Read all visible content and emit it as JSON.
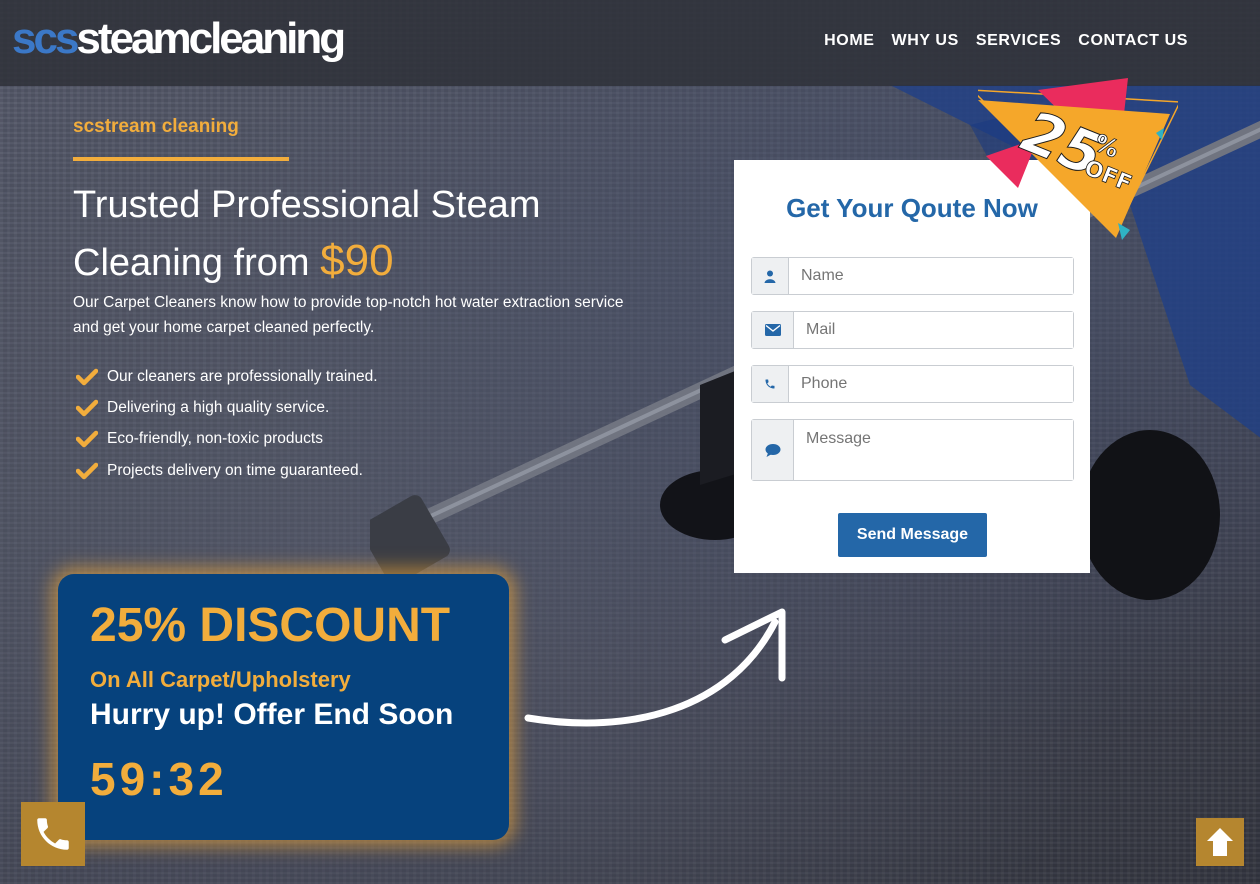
{
  "header": {
    "logo_prefix": "scs",
    "logo_suffix": "steamcleaning",
    "nav": [
      "HOME",
      "WHY US",
      "SERVICES",
      "CONTACT US"
    ]
  },
  "hero": {
    "kicker": "scstream cleaning",
    "headline_line1": "Trusted Professional Steam",
    "headline_line2": "Cleaning from ",
    "price": "$90",
    "lead": "Our Carpet Cleaners know how to provide top-notch hot water extraction service and get your home carpet cleaned perfectly.",
    "bullets": [
      "Our cleaners are professionally trained.",
      "Delivering a high quality service.",
      "Eco-friendly, non-toxic products",
      "Projects delivery on time guaranteed."
    ]
  },
  "promo": {
    "title": "25% DISCOUNT",
    "subtitle": "On All Carpet/Upholstery",
    "hurry": "Hurry up! Offer End Soon",
    "timer": "59:32"
  },
  "form": {
    "title": "Get Your Qoute Now",
    "name_placeholder": "Name",
    "mail_placeholder": "Mail",
    "phone_placeholder": "Phone",
    "message_placeholder": "Message",
    "submit_label": "Send Message"
  },
  "badge": {
    "number": "25",
    "percent": "%",
    "off": "OFF"
  },
  "colors": {
    "accent": "#f2ad3c",
    "brand_blue": "#2467a8",
    "promo_bg": "#06427d",
    "button_gold": "#b5862f"
  },
  "icons": {
    "name_field": "user-icon",
    "mail_field": "envelope-icon",
    "phone_field": "phone-icon",
    "message_field": "comment-icon",
    "floating_call": "phone-icon",
    "scroll_top": "arrow-up-icon"
  }
}
